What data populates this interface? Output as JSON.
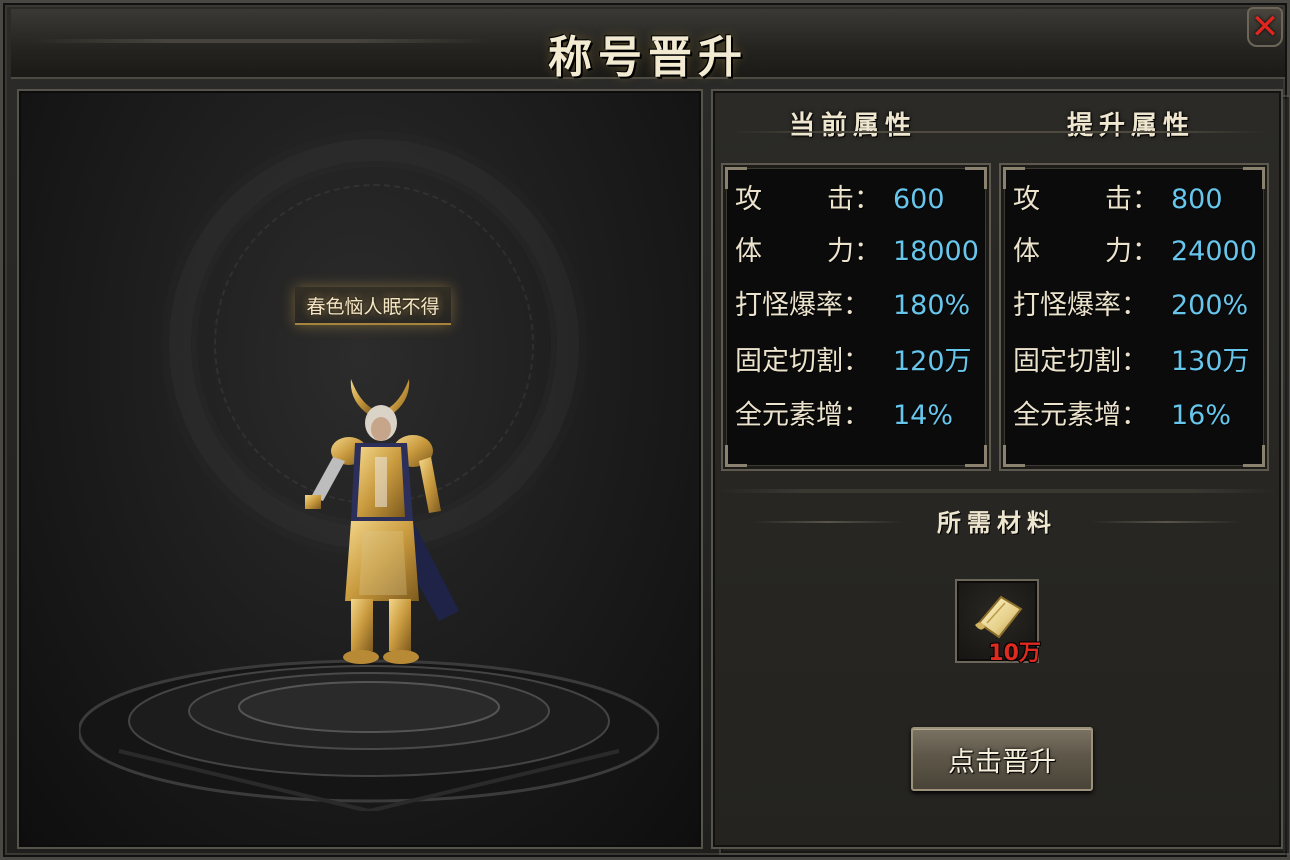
{
  "window": {
    "title": "称号晋升",
    "close_symbol": "✕"
  },
  "preview": {
    "title_tag": "春色恼人眠不得"
  },
  "stats": {
    "current_header": "当前属性",
    "upgrade_header": "提升属性",
    "current": [
      {
        "label_a": "攻",
        "label_b": "击：",
        "value": "600"
      },
      {
        "label_a": "体",
        "label_b": "力：",
        "value": "18000"
      },
      {
        "label_a": "打怪爆率：",
        "label_b": "",
        "value": "180%"
      },
      {
        "label_a": "固定切割：",
        "label_b": "",
        "value": "120万"
      },
      {
        "label_a": "全元素增：",
        "label_b": "",
        "value": "14%"
      }
    ],
    "upgrade": [
      {
        "label_a": "攻",
        "label_b": "击：",
        "value": "800"
      },
      {
        "label_a": "体",
        "label_b": "力：",
        "value": "24000"
      },
      {
        "label_a": "打怪爆率：",
        "label_b": "",
        "value": "200%"
      },
      {
        "label_a": "固定切割：",
        "label_b": "",
        "value": "130万"
      },
      {
        "label_a": "全元素增：",
        "label_b": "",
        "value": "16%"
      }
    ]
  },
  "materials": {
    "header": "所需材料",
    "item": {
      "icon": "scroll-icon",
      "count": "10万"
    }
  },
  "actions": {
    "upgrade_label": "点击晋升"
  },
  "colors": {
    "stat_value": "#67c6ec",
    "count_red": "#e02a1f",
    "close_red": "#e0261f"
  }
}
